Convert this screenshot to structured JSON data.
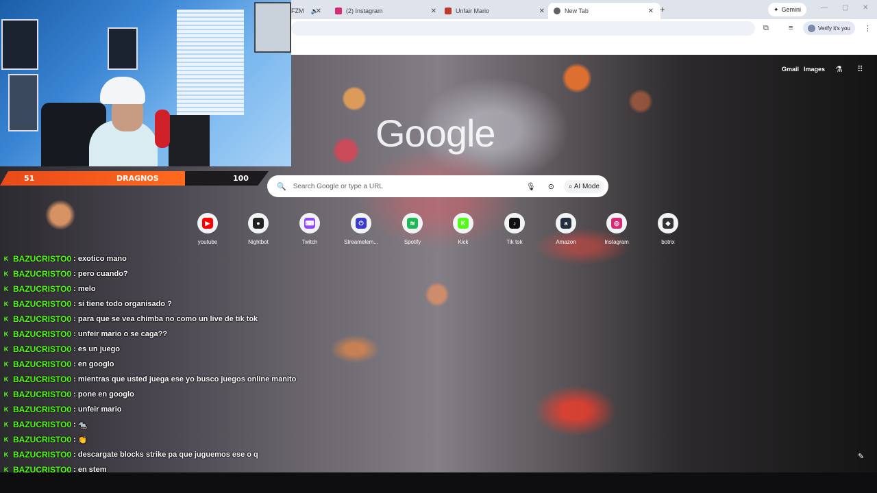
{
  "browser": {
    "tabs": [
      {
        "label": "FZM",
        "favicon_color": "#e05030",
        "closable": true
      },
      {
        "label": "(2) Instagram",
        "favicon_color": "#d62976",
        "closable": true
      },
      {
        "label": "Unfair Mario",
        "favicon_color": "#c0392b",
        "closable": true
      },
      {
        "label": "New Tab",
        "favicon_color": "#5f6368",
        "closable": true,
        "active": true
      }
    ],
    "new_tab_symbol": "+",
    "close_symbol": "✕",
    "gemini_label": "Gemini",
    "verify_label": "Verify it's you",
    "window_controls": [
      "—",
      "▢",
      "✕"
    ]
  },
  "new_tab_page": {
    "top_links": [
      "Gmail",
      "Images"
    ],
    "logo_text": "Google",
    "search": {
      "placeholder": "Search Google or type a URL",
      "ai_mode_label": "AI Mode"
    },
    "shortcuts": [
      {
        "label": "youtube",
        "icon": "youtube-icon",
        "glyph": "▶",
        "color": "#ff0000"
      },
      {
        "label": "Nightbot",
        "icon": "nightbot-icon",
        "glyph": "●",
        "color": "#222222"
      },
      {
        "label": "Twitch",
        "icon": "twitch-icon",
        "glyph": "⌨",
        "color": "#9146ff"
      },
      {
        "label": "Streamelem...",
        "icon": "streamelements-icon",
        "glyph": "⏻",
        "color": "#3a3ad0"
      },
      {
        "label": "Spotify",
        "icon": "spotify-icon",
        "glyph": "≋",
        "color": "#1db954"
      },
      {
        "label": "Kick",
        "icon": "kick-icon",
        "glyph": "K",
        "color": "#53fc18"
      },
      {
        "label": "Tik tok",
        "icon": "tiktok-icon",
        "glyph": "♪",
        "color": "#111111"
      },
      {
        "label": "Amazon",
        "icon": "amazon-icon",
        "glyph": "a",
        "color": "#232f3e"
      },
      {
        "label": "Instagram",
        "icon": "instagram-icon",
        "glyph": "◎",
        "color": "#d62976"
      },
      {
        "label": "botrix",
        "icon": "botrix-icon",
        "glyph": "◆",
        "color": "#333333"
      }
    ]
  },
  "overlay": {
    "scoreboard": {
      "left_score": "51",
      "name": "DRAGNOS",
      "right_score": "100"
    },
    "chat": [
      {
        "user": "BAZUCRISTO0",
        "msg": "exotico mano"
      },
      {
        "user": "BAZUCRISTO0",
        "msg": "pero cuando?"
      },
      {
        "user": "BAZUCRISTO0",
        "msg": "melo"
      },
      {
        "user": "BAZUCRISTO0",
        "msg": "si tiene todo organisado ?"
      },
      {
        "user": "BAZUCRISTO0",
        "msg": "para que se vea chimba no como un live de tik tok"
      },
      {
        "user": "BAZUCRISTO0",
        "msg": "unfeir mario o se caga??"
      },
      {
        "user": "BAZUCRISTO0",
        "msg": "es un juego"
      },
      {
        "user": "BAZUCRISTO0",
        "msg": "en googlo"
      },
      {
        "user": "BAZUCRISTO0",
        "msg": "mientras que usted juega ese yo busco juegos online manito"
      },
      {
        "user": "BAZUCRISTO0",
        "msg": "pone en googlo"
      },
      {
        "user": "BAZUCRISTO0",
        "msg": "unfeir mario"
      },
      {
        "user": "BAZUCRISTO0",
        "msg": "🐀"
      },
      {
        "user": "BAZUCRISTO0",
        "msg": "👏"
      },
      {
        "user": "BAZUCRISTO0",
        "msg": "descargate blocks strike pa que juguemos ese o q"
      },
      {
        "user": "BAZUCRISTO0",
        "msg": "en stem"
      }
    ]
  }
}
